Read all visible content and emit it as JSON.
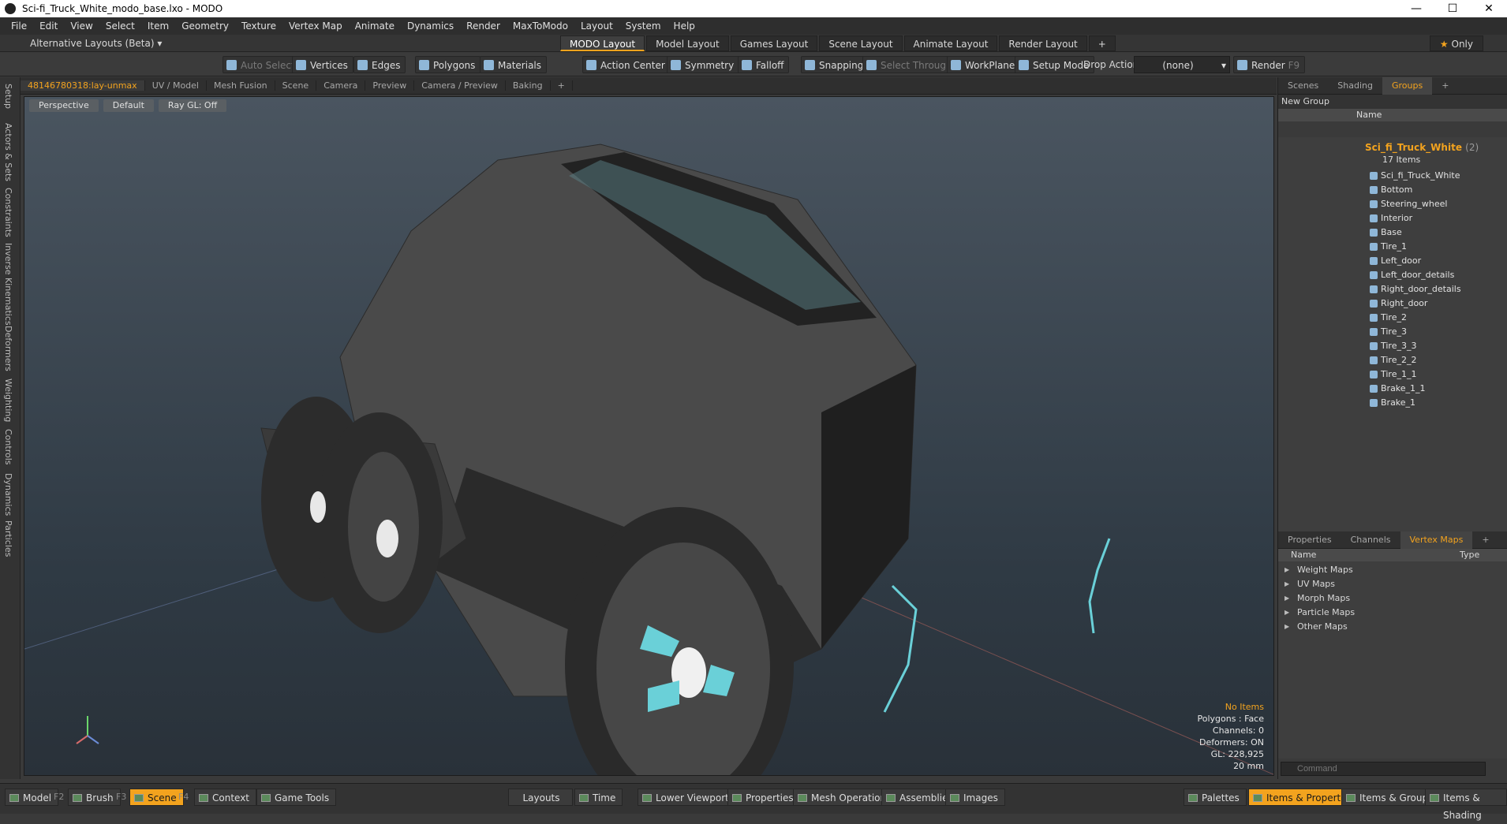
{
  "window": {
    "title": "Sci-fi_Truck_White_modo_base.lxo - MODO"
  },
  "menu": [
    "File",
    "Edit",
    "View",
    "Select",
    "Item",
    "Geometry",
    "Texture",
    "Vertex Map",
    "Animate",
    "Dynamics",
    "Render",
    "MaxToModo",
    "Layout",
    "System",
    "Help"
  ],
  "layout_bar": {
    "alt_layouts": "Alternative Layouts (Beta)",
    "tabs": [
      "MODO Layout",
      "Model Layout",
      "Games Layout",
      "Scene Layout",
      "Animate Layout",
      "Render Layout"
    ],
    "active_tab": "MODO Layout",
    "only_label": "Only"
  },
  "toolbar": {
    "auto_select": "Auto Select",
    "vertices": "Vertices",
    "edges": "Edges",
    "polygons": "Polygons",
    "materials": "Materials",
    "action_center": "Action Center",
    "symmetry": "Symmetry",
    "falloff": "Falloff",
    "snapping": "Snapping",
    "select_through": "Select Through",
    "workplane": "WorkPlane",
    "setup_mode": "Setup Mode",
    "drop_action": "Drop Action",
    "drop_value": "(none)",
    "render": "Render",
    "render_key": "F9"
  },
  "left_tabs": [
    "Setup",
    "Actors & Sets",
    "Constraints",
    "Inverse Kinematics",
    "Deformers",
    "Weighting",
    "Controls",
    "Dynamics",
    "Particles"
  ],
  "viewport_tabs": [
    "48146780318:lay-unmax",
    "UV / Model",
    "Mesh Fusion",
    "Scene",
    "Camera",
    "Preview",
    "Camera / Preview",
    "Baking"
  ],
  "viewport": {
    "header": [
      "Perspective",
      "Default",
      "Ray GL: Off"
    ],
    "info": {
      "items": "No Items",
      "polygons": "Polygons : Face",
      "channels": "Channels: 0",
      "deformers": "Deformers: ON",
      "gl": "GL: 228,925",
      "scale": "20 mm"
    }
  },
  "right_panel": {
    "tabs": [
      "Scenes",
      "Shading",
      "Groups"
    ],
    "active_tab": "Groups",
    "new_group": "New Group",
    "name_col": "Name",
    "root": "Sci_fi_Truck_White",
    "root_count": "(2)",
    "items_count": "17 Items",
    "items": [
      "Sci_fi_Truck_White",
      "Bottom",
      "Steering_wheel",
      "Interior",
      "Base",
      "Tire_1",
      "Left_door",
      "Left_door_details",
      "Right_door_details",
      "Right_door",
      "Tire_2",
      "Tire_3",
      "Tire_3_3",
      "Tire_2_2",
      "Tire_1_1",
      "Brake_1_1",
      "Brake_1"
    ]
  },
  "vmap_panel": {
    "tabs": [
      "Properties",
      "Channels",
      "Vertex Maps"
    ],
    "active_tab": "Vertex Maps",
    "name_col": "Name",
    "type_col": "Type",
    "items": [
      "Weight Maps",
      "UV Maps",
      "Morph Maps",
      "Particle Maps",
      "Other Maps"
    ]
  },
  "command": {
    "placeholder": "Command"
  },
  "statusbar": {
    "model": "Model",
    "model_key": "F2",
    "brush": "Brush",
    "brush_key": "F3",
    "scene": "Scene",
    "scene_key": "F4",
    "context": "Context",
    "game_tools": "Game Tools",
    "layouts": "Layouts",
    "time": "Time",
    "lower_viewports": "Lower Viewports",
    "properties": "Properties",
    "mesh_operations": "Mesh Operations",
    "assemblies": "Assemblies",
    "images": "Images",
    "palettes": "Palettes",
    "items_properties": "Items & Properties",
    "items_groups": "Items & Groups",
    "items_shading": "Items & Shading"
  }
}
